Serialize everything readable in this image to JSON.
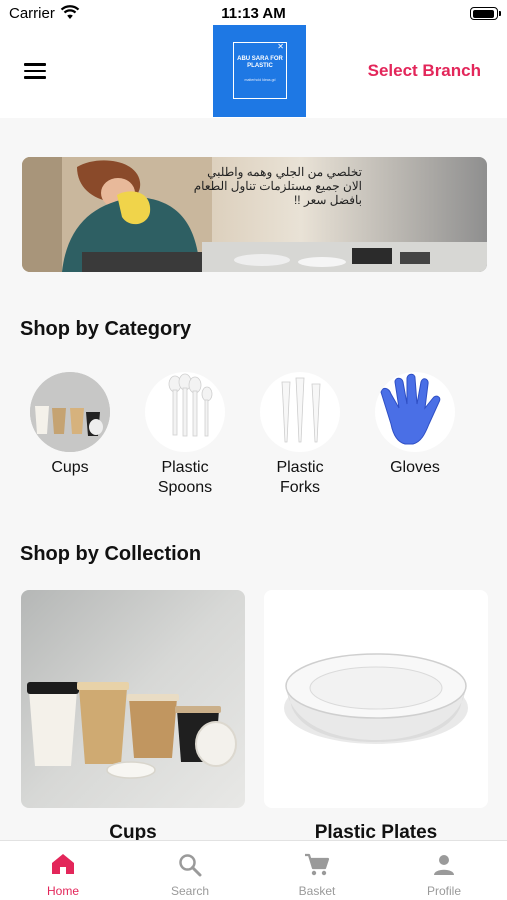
{
  "status_bar": {
    "carrier": "Carrier",
    "time": "11:13 AM"
  },
  "header": {
    "select_branch": "Select Branch",
    "logo": {
      "title": "ABU SARA FOR PLASTIC",
      "subtitle": "matterhold Ideas.gd"
    }
  },
  "banner": {
    "text": "تخلصي من الجلي وهمه واطلبي الان جميع مستلزمات تناول الطعام بافضل سعر !!"
  },
  "shop_by_category": {
    "title": "Shop by Category",
    "items": [
      {
        "label": "Cups",
        "icon": "cups-image"
      },
      {
        "label": "Plastic Spoons",
        "icon": "spoons-image"
      },
      {
        "label": "Plastic Forks",
        "icon": "forks-image"
      },
      {
        "label": "Gloves",
        "icon": "gloves-image"
      }
    ]
  },
  "shop_by_collection": {
    "title": "Shop by Collection",
    "items": [
      {
        "label": "Cups",
        "icon": "cups-collection-image"
      },
      {
        "label": "Plastic Plates",
        "icon": "plates-collection-image"
      }
    ]
  },
  "tab_bar": {
    "active": "Home",
    "tabs": [
      {
        "label": "Home",
        "icon": "home-icon"
      },
      {
        "label": "Search",
        "icon": "search-icon"
      },
      {
        "label": "Basket",
        "icon": "cart-icon"
      },
      {
        "label": "Profile",
        "icon": "profile-icon"
      }
    ]
  },
  "colors": {
    "accent": "#e3265a",
    "logo_bg": "#1e78e4",
    "page_bg": "#f7f7f7",
    "inactive": "#9a9a9a"
  }
}
